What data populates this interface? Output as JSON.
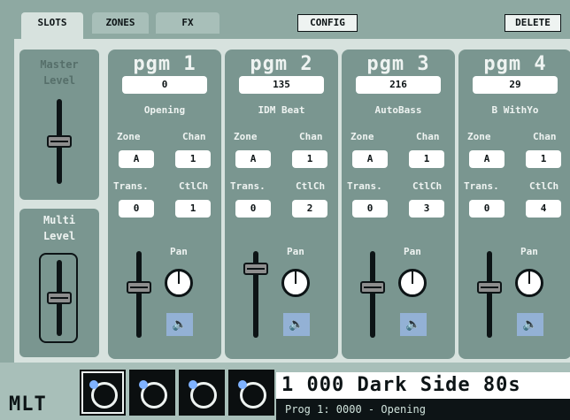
{
  "tabs": [
    {
      "label": "SLOTS",
      "active": true
    },
    {
      "label": "ZONES",
      "active": false
    },
    {
      "label": "FX",
      "active": false
    }
  ],
  "toolbar": {
    "config_label": "CONFIG",
    "delete_label": "DELETE"
  },
  "master": {
    "label_line1": "Master",
    "label_line2": "Level",
    "level": 0.5
  },
  "multi": {
    "label_line1": "Multi",
    "label_line2": "Level",
    "level": 0.5
  },
  "slots": [
    {
      "pgm": "pgm 1",
      "number": "0",
      "name": "Opening",
      "zone_label": "Zone",
      "chan_label": "Chan",
      "zone": "A",
      "chan": "1",
      "trans_label": "Trans.",
      "ctlch_label": "CtlCh",
      "trans": "0",
      "ctlch": "1",
      "pan_label": "Pan",
      "level": 0.6
    },
    {
      "pgm": "pgm 2",
      "number": "135",
      "name": "IDM Beat",
      "zone_label": "Zone",
      "chan_label": "Chan",
      "zone": "A",
      "chan": "1",
      "trans_label": "Trans.",
      "ctlch_label": "CtlCh",
      "trans": "0",
      "ctlch": "2",
      "pan_label": "Pan",
      "level": 0.85
    },
    {
      "pgm": "pgm 3",
      "number": "216",
      "name": "AutoBass",
      "zone_label": "Zone",
      "chan_label": "Chan",
      "zone": "A",
      "chan": "1",
      "trans_label": "Trans.",
      "ctlch_label": "CtlCh",
      "trans": "0",
      "ctlch": "3",
      "pan_label": "Pan",
      "level": 0.6
    },
    {
      "pgm": "pgm 4",
      "number": "29",
      "name": "B WithYo",
      "zone_label": "Zone",
      "chan_label": "Chan",
      "zone": "A",
      "chan": "1",
      "trans_label": "Trans.",
      "ctlch_label": "CtlCh",
      "trans": "0",
      "ctlch": "4",
      "pan_label": "Pan",
      "level": 0.6
    }
  ],
  "bottom": {
    "mode_label": "MLT",
    "program_title": "1 000 Dark Side 80s",
    "program_info": "Prog 1: 0000 - Opening"
  },
  "colors": {
    "panel": "#7a9690",
    "background": "#8ea9a2",
    "accent": "#93b1d5"
  },
  "icons": {
    "speaker": "speaker-icon",
    "pan": "pan-knob-icon",
    "keyswitch": "keyswitch-icon"
  }
}
